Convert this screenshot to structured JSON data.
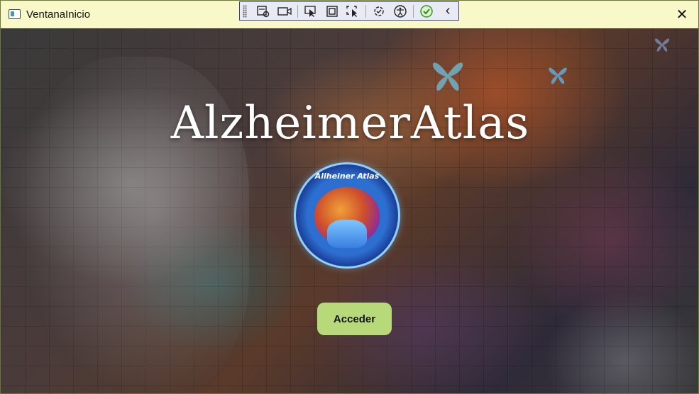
{
  "window": {
    "title": "VentanaInicio",
    "icon": "window-app-icon",
    "close_glyph": "✕"
  },
  "debug_toolbar": {
    "buttons": [
      {
        "name": "live-visual-tree-icon"
      },
      {
        "name": "video-record-icon"
      },
      {
        "name": "select-element-icon"
      },
      {
        "name": "display-layout-adorners-icon"
      },
      {
        "name": "track-focused-element-icon"
      },
      {
        "name": "binding-failures-icon"
      },
      {
        "name": "accessibility-icon"
      },
      {
        "name": "checkmark-icon"
      },
      {
        "name": "collapse-chevron-icon",
        "glyph": "‹"
      }
    ]
  },
  "main": {
    "title": "AlzheimerAtlas",
    "logo_text": "Allheiner Atlas",
    "button_label": "Acceder"
  },
  "colors": {
    "titlebar_bg": "#f8f8c8",
    "button_bg": "#b8d97a",
    "title_text": "#ffffff"
  }
}
